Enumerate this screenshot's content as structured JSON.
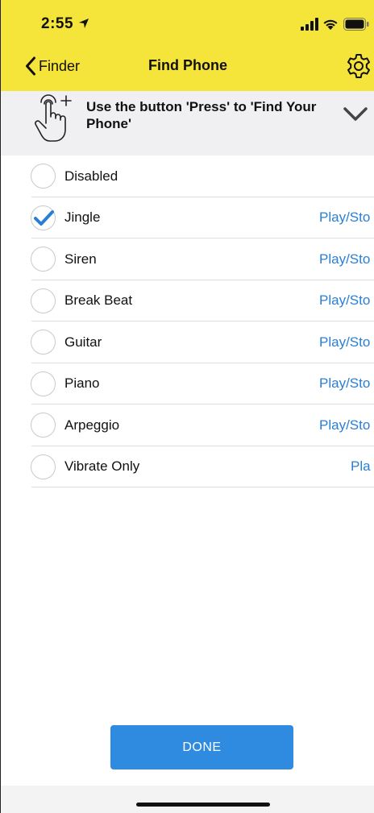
{
  "status_bar": {
    "time": "2:55",
    "icons": [
      "location-arrow-icon",
      "cellular-signal-icon",
      "wifi-icon",
      "battery-icon"
    ]
  },
  "nav": {
    "back_label": "Finder",
    "title": "Find Phone",
    "settings_icon": "gear-icon"
  },
  "banner": {
    "text": "Use the button 'Press' to 'Find Your Phone'",
    "icon": "hand-tap-icon",
    "expand_icon": "chevron-down-icon"
  },
  "options": [
    {
      "label": "Disabled",
      "action": "",
      "selected": false
    },
    {
      "label": "Jingle",
      "action": "Play/Sto",
      "selected": true
    },
    {
      "label": "Siren",
      "action": "Play/Sto",
      "selected": false
    },
    {
      "label": "Break Beat",
      "action": "Play/Sto",
      "selected": false
    },
    {
      "label": "Guitar",
      "action": "Play/Sto",
      "selected": false
    },
    {
      "label": "Piano",
      "action": "Play/Sto",
      "selected": false
    },
    {
      "label": "Arpeggio",
      "action": "Play/Sto",
      "selected": false
    },
    {
      "label": "Vibrate Only",
      "action": "Pla",
      "selected": false
    }
  ],
  "done_label": "DONE",
  "colors": {
    "header_yellow": "#f5e43a",
    "banner_gray": "#f0f0f2",
    "accent_blue": "#2a7fd4",
    "button_blue": "#2f8be0"
  }
}
